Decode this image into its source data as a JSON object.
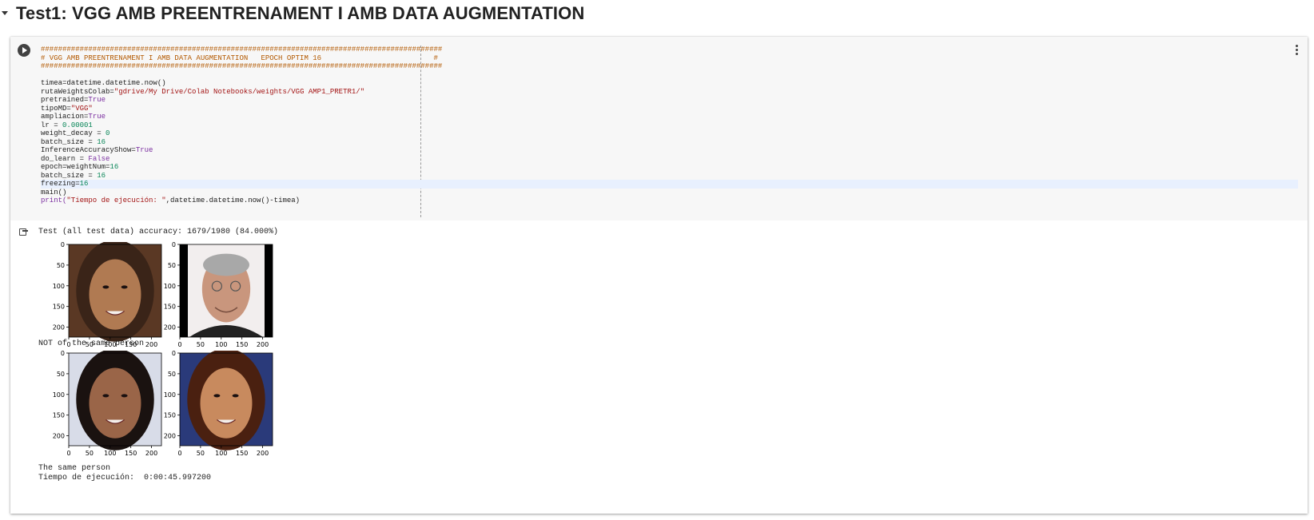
{
  "section": {
    "title": "Test1: VGG AMB PREENTRENAMENT I AMB DATA AUGMENTATION"
  },
  "cell": {
    "run_icon": "play-circle-icon",
    "menu_icon": "more-vert-icon",
    "code_lines": [
      {
        "t": "comment",
        "text": "#############################################################################################"
      },
      {
        "t": "comment",
        "text": "# VGG AMB PREENTRENAMENT I AMB DATA AUGMENTATION   EPOCH OPTIM 16                          #"
      },
      {
        "t": "comment",
        "text": "#############################################################################################"
      },
      {
        "t": "blank",
        "text": ""
      },
      {
        "t": "plain",
        "text": "timea=datetime.datetime.now()"
      },
      {
        "t": "str",
        "a": "rutaWeightsColab=",
        "b": "\"gdrive/My Drive/Colab Notebooks/weights/VGG AMP1_PRETR1/\""
      },
      {
        "t": "kw",
        "a": "pretrained=",
        "b": "True"
      },
      {
        "t": "str",
        "a": "tipoMD=",
        "b": "\"VGG\""
      },
      {
        "t": "kw",
        "a": "ampliacion=",
        "b": "True"
      },
      {
        "t": "num",
        "a": "lr = ",
        "b": "0.00001"
      },
      {
        "t": "num",
        "a": "weight_decay = ",
        "b": "0"
      },
      {
        "t": "num",
        "a": "batch_size = ",
        "b": "16"
      },
      {
        "t": "kw",
        "a": "InferenceAccuracyShow=",
        "b": "True"
      },
      {
        "t": "kw",
        "a": "do_learn = ",
        "b": "False"
      },
      {
        "t": "num",
        "a": "epoch=weightNum=",
        "b": "16"
      },
      {
        "t": "num",
        "a": "batch_size = ",
        "b": "16"
      },
      {
        "t": "num",
        "a": "freezing=",
        "b": "16",
        "highlight": true
      },
      {
        "t": "plain",
        "text": "main()"
      },
      {
        "t": "print",
        "a": "print(",
        "b": "\"Tiempo de ejecución: \"",
        "c": ",datetime.datetime.now()-timea)"
      }
    ]
  },
  "output": {
    "icon": "output-redirect-icon",
    "accuracy_text": "Test (all test data) accuracy: 1679/1980 (84.000%)",
    "result1": "NOT of the same person",
    "result2": "The same person",
    "time_text": "Tiempo de ejecución:  0:00:45.997200",
    "axis_ticks": {
      "y": [
        "0",
        "50",
        "100",
        "150",
        "200"
      ],
      "x": [
        "0",
        "50",
        "100",
        "150",
        "200"
      ]
    },
    "figures": [
      {
        "name": "face-image-woman-1",
        "palette": [
          "#3a2418",
          "#8a5a3a",
          "#b07a52",
          "#5a3824"
        ]
      },
      {
        "name": "face-image-man-glasses",
        "palette": [
          "#000000",
          "#f2eeee",
          "#c9967d",
          "#222222"
        ]
      },
      {
        "name": "face-image-woman-2",
        "palette": [
          "#1a1210",
          "#6a4030",
          "#9a6548",
          "#d8dce8"
        ]
      },
      {
        "name": "face-image-woman-3",
        "palette": [
          "#4a2010",
          "#b07048",
          "#c88a5e",
          "#2a3a7a"
        ]
      }
    ]
  }
}
